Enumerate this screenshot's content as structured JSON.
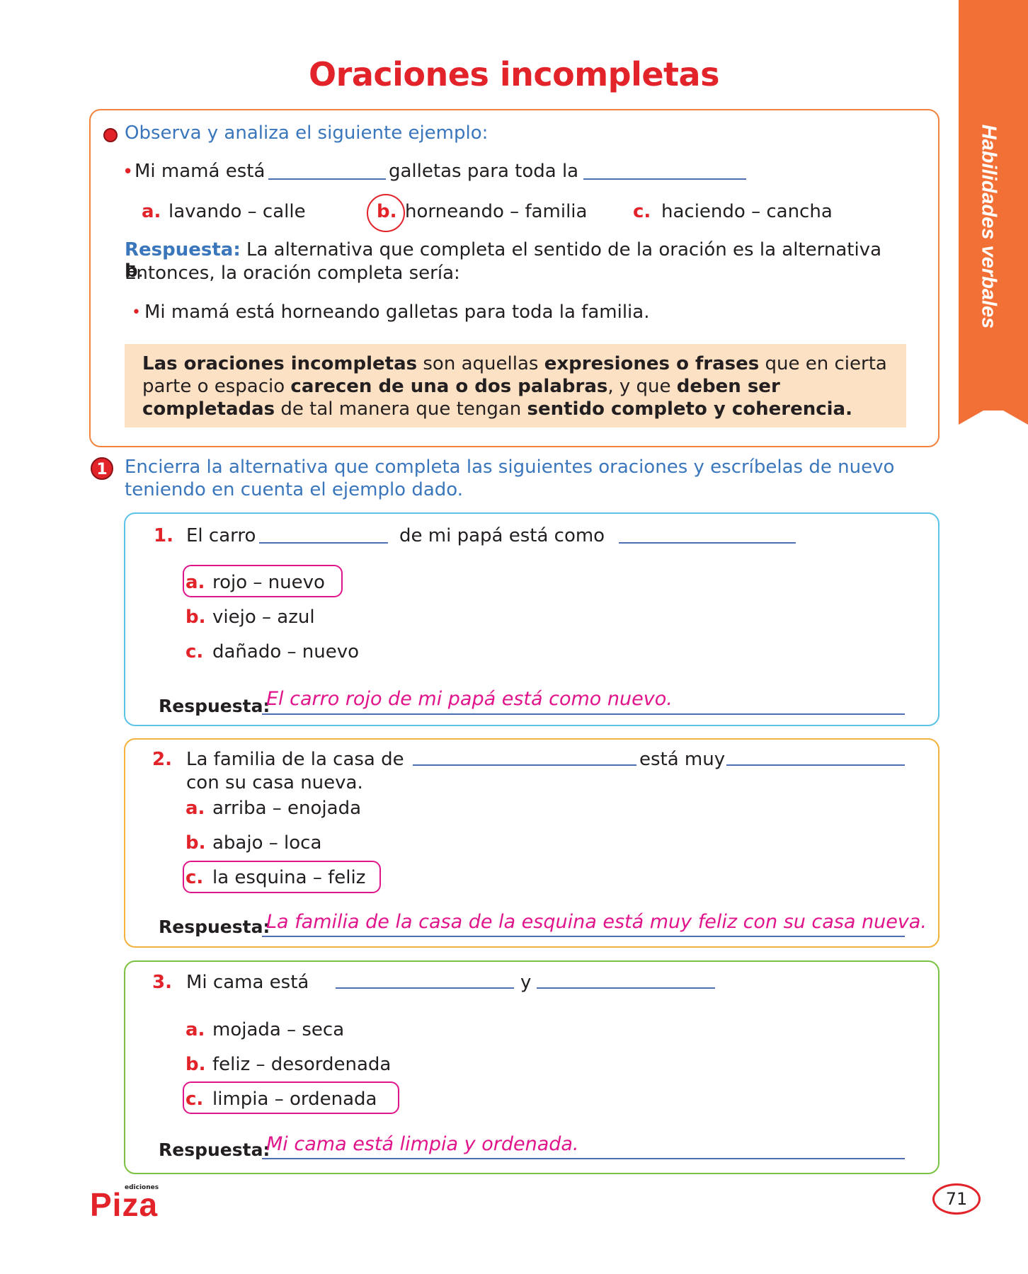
{
  "title": "Oraciones incompletas",
  "side_tab": "Habilidades verbales",
  "example": {
    "instruction": "Observa y analiza el siguiente ejemplo:",
    "sentence_part1": "Mi mamá está",
    "sentence_part2": "galletas para toda la",
    "options": [
      {
        "letter": "a.",
        "text": "lavando – calle"
      },
      {
        "letter": "b.",
        "text": "horneando – familia"
      },
      {
        "letter": "c.",
        "text": "haciendo – cancha"
      }
    ],
    "answer_label": "Respuesta:",
    "answer_text": "La alternativa que completa el sentido de la oración es la alternativa",
    "answer_letter": "b",
    "answer_dot": ".",
    "answer_line2": "Entonces, la oración completa sería:",
    "complete_sentence": "Mi mamá está horneando galletas para toda la familia.",
    "definition": {
      "p1": "Las oraciones incompletas",
      "p2": " son aquellas ",
      "p3": "expresiones o frases",
      "p4": " que en cierta parte o espacio ",
      "p5": "carecen de una o dos palabras",
      "p6": ", y que ",
      "p7": "deben ser completadas",
      "p8": " de tal manera que tengan ",
      "p9": "sentido completo y coherencia."
    }
  },
  "exercise": {
    "number": "1",
    "instruction_line1": "Encierra la alternativa que completa las siguientes oraciones y escríbelas de nuevo",
    "instruction_line2": "teniendo en cuenta el ejemplo dado."
  },
  "questions": [
    {
      "number": "1.",
      "part1": "El carro",
      "part2": "de mi papá está como",
      "options": [
        {
          "letter": "a.",
          "text": "rojo – nuevo",
          "selected": true
        },
        {
          "letter": "b.",
          "text": "viejo – azul",
          "selected": false
        },
        {
          "letter": "c.",
          "text": "dañado – nuevo",
          "selected": false
        }
      ],
      "answer_label": "Respuesta:",
      "answer": "El carro rojo de mi papá está como nuevo."
    },
    {
      "number": "2.",
      "part1": "La familia de la casa de",
      "part2": "está muy",
      "part3": "con su casa nueva.",
      "options": [
        {
          "letter": "a.",
          "text": "arriba – enojada",
          "selected": false
        },
        {
          "letter": "b.",
          "text": "abajo – loca",
          "selected": false
        },
        {
          "letter": "c.",
          "text": "la esquina – feliz",
          "selected": true
        }
      ],
      "answer_label": "Respuesta:",
      "answer": "La familia de la casa de la esquina está muy feliz con su casa nueva."
    },
    {
      "number": "3.",
      "part1": "Mi cama está",
      "part2": "y",
      "options": [
        {
          "letter": "a.",
          "text": "mojada – seca",
          "selected": false
        },
        {
          "letter": "b.",
          "text": "feliz – desordenada",
          "selected": false
        },
        {
          "letter": "c.",
          "text": "limpia – ordenada",
          "selected": true
        }
      ],
      "answer_label": "Respuesta:",
      "answer": "Mi cama está limpia y ordenada."
    }
  ],
  "footer": {
    "logo_small": "ediciones",
    "logo": "Piza",
    "page_number": "71"
  },
  "colors": {
    "title_red": "#e2232a",
    "instruction_blue": "#3a76bb",
    "answer_magenta": "#e0148b",
    "side_tab_orange": "#f26f36",
    "definition_bg": "#fde1c4"
  }
}
